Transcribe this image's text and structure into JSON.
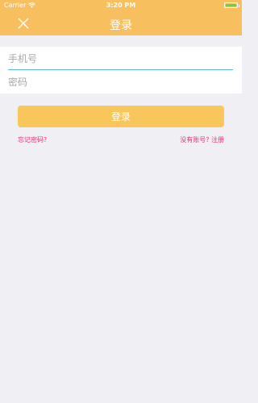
{
  "status_bar": {
    "carrier": "Carrier",
    "time": "3:20 PM",
    "battery_color": "#4cd964"
  },
  "nav": {
    "title": "登录",
    "close_icon": "close-icon",
    "background": "#f8bf5f"
  },
  "form": {
    "phone": {
      "placeholder": "手机号",
      "value": ""
    },
    "password": {
      "placeholder": "密码",
      "value": ""
    }
  },
  "login_button": {
    "label": "登录",
    "color": "#f8c65a"
  },
  "links": {
    "forgot_password": "忘记密码?",
    "no_account": "没有账号?",
    "register": "注册",
    "color": "#e8336f"
  }
}
